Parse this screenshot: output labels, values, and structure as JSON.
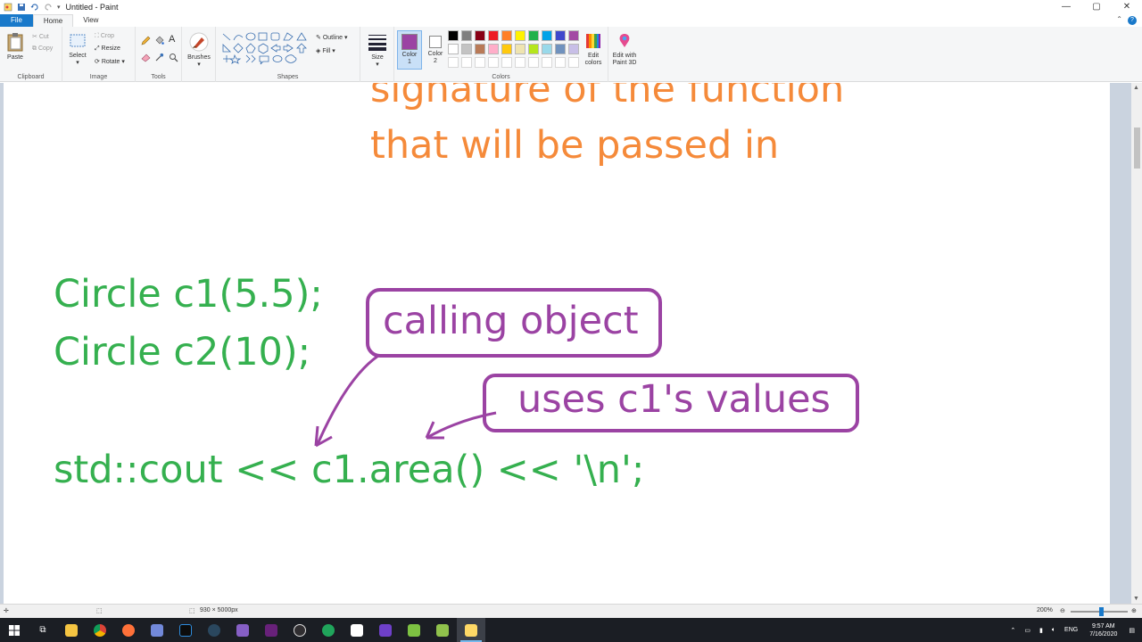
{
  "window": {
    "title": "Untitled - Paint",
    "minimize": "—",
    "maximize": "▢",
    "close": "✕"
  },
  "tabs": [
    "File",
    "Home",
    "View"
  ],
  "ribbon": {
    "clipboard": {
      "paste": "Paste",
      "cut": "Cut",
      "copy": "Copy",
      "label": "Clipboard"
    },
    "image": {
      "select": "Select",
      "crop": "Crop",
      "resize": "Resize",
      "rotate": "Rotate",
      "label": "Image"
    },
    "tools": {
      "label": "Tools"
    },
    "brushes": "Brushes",
    "shapes": {
      "outline": "Outline",
      "fill": "Fill",
      "label": "Shapes"
    },
    "size": "Size",
    "color1": [
      "Color",
      "1"
    ],
    "color2": [
      "Color",
      "2"
    ],
    "colors_label": "Colors",
    "edit_colors": [
      "Edit",
      "colors"
    ],
    "edit_3d": [
      "Edit with",
      "Paint 3D"
    ],
    "color1_value": "#9b43a3",
    "color2_value": "#ffffff",
    "palette_row1": [
      "#000000",
      "#7f7f7f",
      "#880015",
      "#ed1c24",
      "#ff7f27",
      "#fff200",
      "#22b14c",
      "#00a2e8",
      "#3f48cc",
      "#a349a4"
    ],
    "palette_row2": [
      "#ffffff",
      "#c3c3c3",
      "#b97a57",
      "#ffaec9",
      "#ffc90e",
      "#efe4b0",
      "#b5e61d",
      "#99d9ea",
      "#7092be",
      "#c8bfe7"
    ]
  },
  "canvas": {
    "orange_line1": "signature of the function",
    "orange_line2": "that will be passed in",
    "code_line1": "Circle c1(5.5);",
    "code_line2": "Circle c2(10);",
    "code_line3": "std::cout << c1.area() << '\\n';",
    "note1": "calling object",
    "note2": "uses c1's values"
  },
  "status": {
    "dimensions": "930 × 5000px",
    "zoom": "200%"
  },
  "tray": {
    "lang": "ENG",
    "time": "9:57 AM",
    "date": "7/16/2020"
  },
  "taskbar_icons": [
    "windows",
    "task-view",
    "file-explorer",
    "chrome",
    "firefox",
    "discord",
    "terminal",
    "steam",
    "visual-studio-2",
    "visual-studio",
    "obs",
    "git",
    "unity",
    "github",
    "notepad",
    "paint"
  ]
}
